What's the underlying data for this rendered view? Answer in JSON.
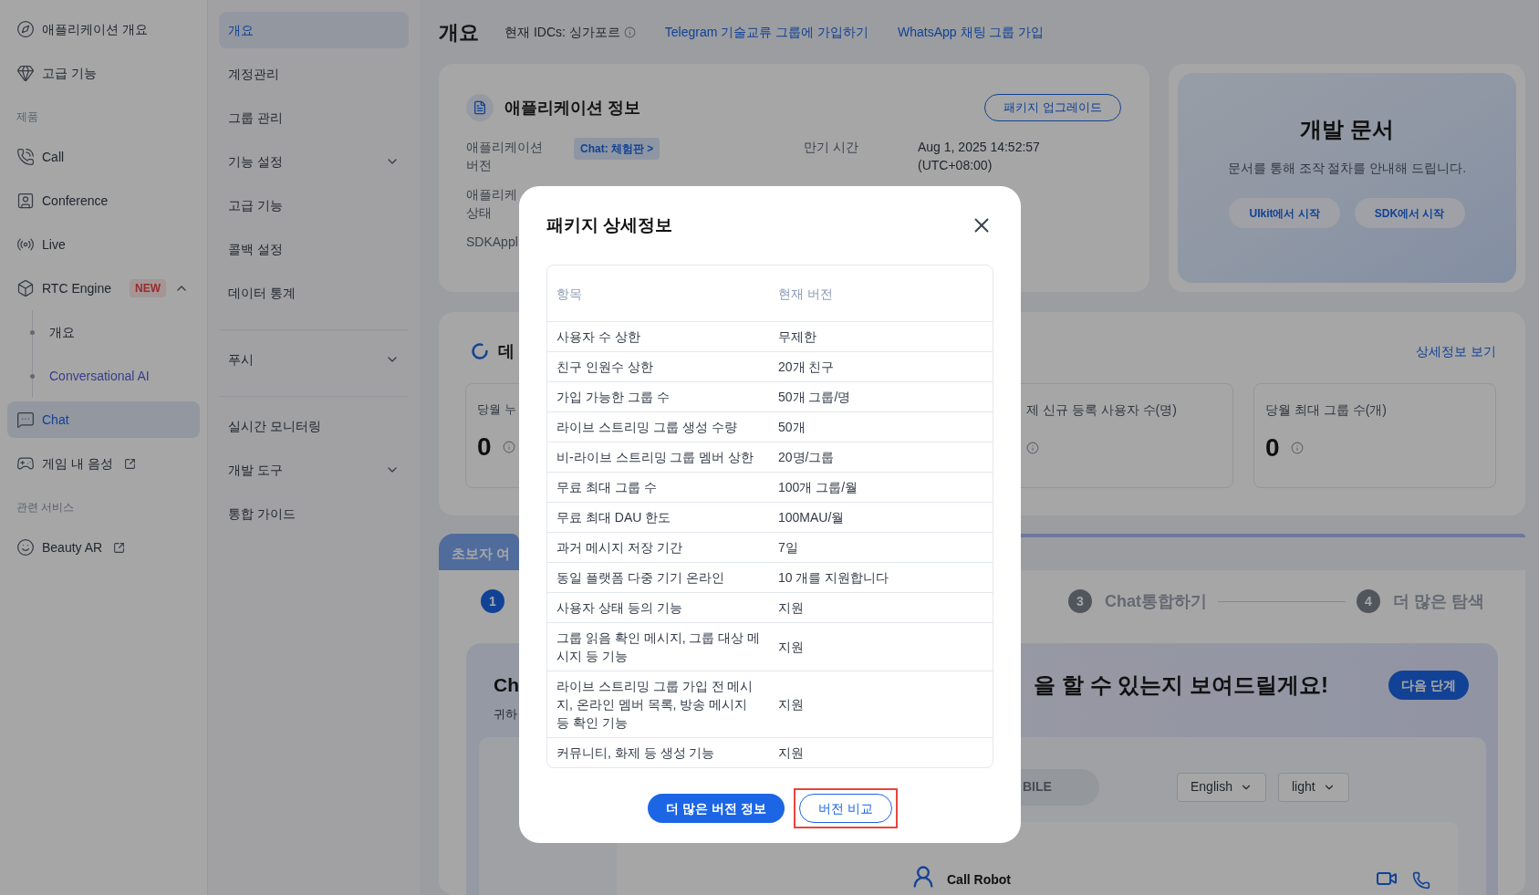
{
  "sidebar": {
    "items": [
      {
        "kind": "item",
        "label": "애플리케이션 개요",
        "selected": false
      },
      {
        "kind": "item",
        "label": "고급 기능",
        "selected": false
      },
      {
        "kind": "heading",
        "label": "제품"
      },
      {
        "kind": "item",
        "label": "Call",
        "selected": false
      },
      {
        "kind": "item",
        "label": "Conference",
        "selected": false
      },
      {
        "kind": "item",
        "label": "Live",
        "selected": false
      },
      {
        "kind": "item",
        "label": "RTC Engine",
        "selected": false,
        "badge": "NEW",
        "expanded": true,
        "children": [
          {
            "label": "개요",
            "highlighted": false
          },
          {
            "label": "Conversational AI",
            "highlighted": true
          }
        ]
      },
      {
        "kind": "item",
        "label": "Chat",
        "selected": true
      },
      {
        "kind": "item",
        "label": "게임 내 음성",
        "selected": false,
        "external": true
      },
      {
        "kind": "heading",
        "label": "관련 서비스"
      },
      {
        "kind": "item",
        "label": "Beauty AR",
        "selected": false,
        "external": true
      }
    ]
  },
  "subnav": {
    "groups": [
      [
        {
          "label": "개요",
          "selected": true
        },
        {
          "label": "계정관리",
          "selected": false
        },
        {
          "label": "그룹 관리",
          "selected": false
        },
        {
          "label": "기능 설정",
          "selected": false,
          "expanded": false
        },
        {
          "label": "고급 기능",
          "selected": false
        },
        {
          "label": "콜백 설정",
          "selected": false
        },
        {
          "label": "데이터 통계",
          "selected": false
        }
      ],
      [
        {
          "label": "푸시",
          "selected": false,
          "expanded": false
        }
      ],
      [
        {
          "label": "실시간 모니터링",
          "selected": false
        },
        {
          "label": "개발 도구",
          "selected": false,
          "expanded": false
        },
        {
          "label": "통합 가이드",
          "selected": false
        }
      ]
    ]
  },
  "header": {
    "title": "개요",
    "idc": "현재 IDCs: 싱가포르",
    "links": [
      "Telegram 기술교류 그룹에 가입하기",
      "WhatsApp 채팅 그룹 가입"
    ]
  },
  "app_info": {
    "title": "애플리케이션 정보",
    "upgrade_button": "패키지 업그레이드",
    "rows": [
      {
        "label": "애플리케이션\n버전",
        "badge": "Chat: 체험판 >",
        "extra_label": "만기 시간",
        "extra_value": "Aug 1, 2025 14:52:57\n(UTC+08:00)"
      },
      {
        "label": "애플리케\n상태"
      },
      {
        "label": "SDKAppl"
      }
    ]
  },
  "dev_docs": {
    "title": "개발 문서",
    "subtitle": "문서를 통해 조작 절차를 안내해 드립니다.",
    "buttons": [
      "UIkit에서 시작",
      "SDK에서 시작"
    ]
  },
  "data_card": {
    "title": "데",
    "link": "상세정보 보기",
    "stats": [
      {
        "label": "당월 누",
        "value": "0"
      },
      {
        "label": "제 신규 등록 사용자 수(명)"
      },
      {
        "label": "당월 최대 그룹 수(개)",
        "value": "0"
      }
    ]
  },
  "guide": {
    "tab": "초보자 여",
    "steps": [
      {
        "number": "1",
        "selected": true
      },
      {
        "number": "3",
        "label": "Chat통합하기",
        "selected": false
      },
      {
        "number": "4",
        "label": "더 많은 탐색",
        "selected": false
      }
    ],
    "heading_start": "Ch",
    "heading_end": "을 할 수 있는지 보여드릴게요!",
    "text": "귀하",
    "next_button": "다음 단계",
    "demo": {
      "tab": "BILE",
      "selects": [
        "English",
        "light"
      ],
      "contact": "Call Robot"
    }
  },
  "modal": {
    "title": "패키지 상세정보",
    "columns": [
      "항목",
      "현재 버전"
    ],
    "rows": [
      [
        "사용자 수 상한",
        "무제한"
      ],
      [
        "친구 인원수 상한",
        "20개 친구"
      ],
      [
        "가입 가능한 그룹 수",
        "50개 그룹/명"
      ],
      [
        "라이브 스트리밍 그룹 생성 수량",
        "50개"
      ],
      [
        "비-라이브 스트리밍 그룹 멤버 상한",
        "20명/그룹"
      ],
      [
        "무료 최대 그룹 수",
        "100개 그룹/월"
      ],
      [
        "무료 최대 DAU 한도",
        "100MAU/월"
      ],
      [
        "과거 메시지 저장 기간",
        "7일"
      ],
      [
        "동일 플랫폼 다중 기기 온라인",
        "10 개를 지원합니다"
      ],
      [
        "사용자 상태 등의 기능",
        "지원"
      ],
      [
        "그룹 읽음 확인 메시지, 그룹 대상 메시지 등 기능",
        "지원"
      ],
      [
        "라이브 스트리밍 그룹 가입 전 메시지, 온라인 멤버 목록, 방송 메시지 등 확인 기능",
        "지원"
      ],
      [
        "커뮤니티, 화제 등 생성 기능",
        "지원"
      ]
    ],
    "buttons": [
      {
        "label": "더 많은 버전 정보",
        "kind": "primary",
        "highlighted": false
      },
      {
        "label": "버전 비교",
        "kind": "secondary",
        "highlighted": true
      }
    ]
  }
}
